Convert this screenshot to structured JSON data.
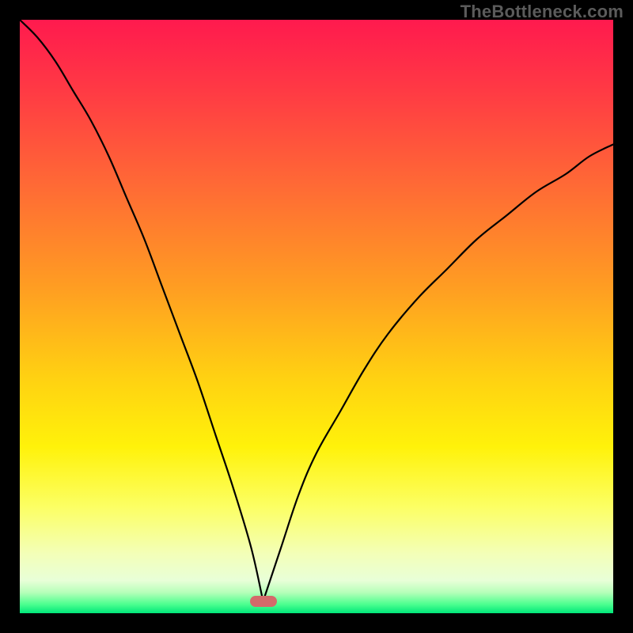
{
  "watermark": "TheBottleneck.com",
  "colors": {
    "frame": "#000000",
    "gradient_stops": [
      {
        "offset": 0.0,
        "color": "#ff1a4e"
      },
      {
        "offset": 0.12,
        "color": "#ff3a44"
      },
      {
        "offset": 0.28,
        "color": "#ff6a35"
      },
      {
        "offset": 0.45,
        "color": "#ff9d22"
      },
      {
        "offset": 0.6,
        "color": "#ffd012"
      },
      {
        "offset": 0.72,
        "color": "#fff20a"
      },
      {
        "offset": 0.82,
        "color": "#fcff63"
      },
      {
        "offset": 0.9,
        "color": "#f3ffb8"
      },
      {
        "offset": 0.945,
        "color": "#e8ffd8"
      },
      {
        "offset": 0.965,
        "color": "#b6ffb9"
      },
      {
        "offset": 0.985,
        "color": "#4cff8f"
      },
      {
        "offset": 1.0,
        "color": "#00e77a"
      }
    ],
    "curve": "#000000",
    "marker": "#d46a6a"
  },
  "chart_data": {
    "type": "line",
    "title": "",
    "xlabel": "",
    "ylabel": "",
    "xlim": [
      0,
      100
    ],
    "ylim": [
      0,
      100
    ],
    "grid": false,
    "legend": false,
    "full_bleed": true,
    "minimum": {
      "x": 41,
      "y": 2
    },
    "marker_at_minimum": true,
    "series": [
      {
        "name": "left-branch",
        "x": [
          0,
          3,
          6,
          9,
          12,
          15,
          18,
          21,
          24,
          27,
          30,
          33,
          36,
          39,
          41
        ],
        "y": [
          100,
          97,
          93,
          88,
          83,
          77,
          70,
          63,
          55,
          47,
          39,
          30,
          21,
          11,
          2
        ]
      },
      {
        "name": "right-branch",
        "x": [
          41,
          44,
          47,
          50,
          54,
          58,
          62,
          67,
          72,
          77,
          82,
          87,
          92,
          96,
          100
        ],
        "y": [
          2,
          11,
          20,
          27,
          34,
          41,
          47,
          53,
          58,
          63,
          67,
          71,
          74,
          77,
          79
        ]
      }
    ]
  }
}
